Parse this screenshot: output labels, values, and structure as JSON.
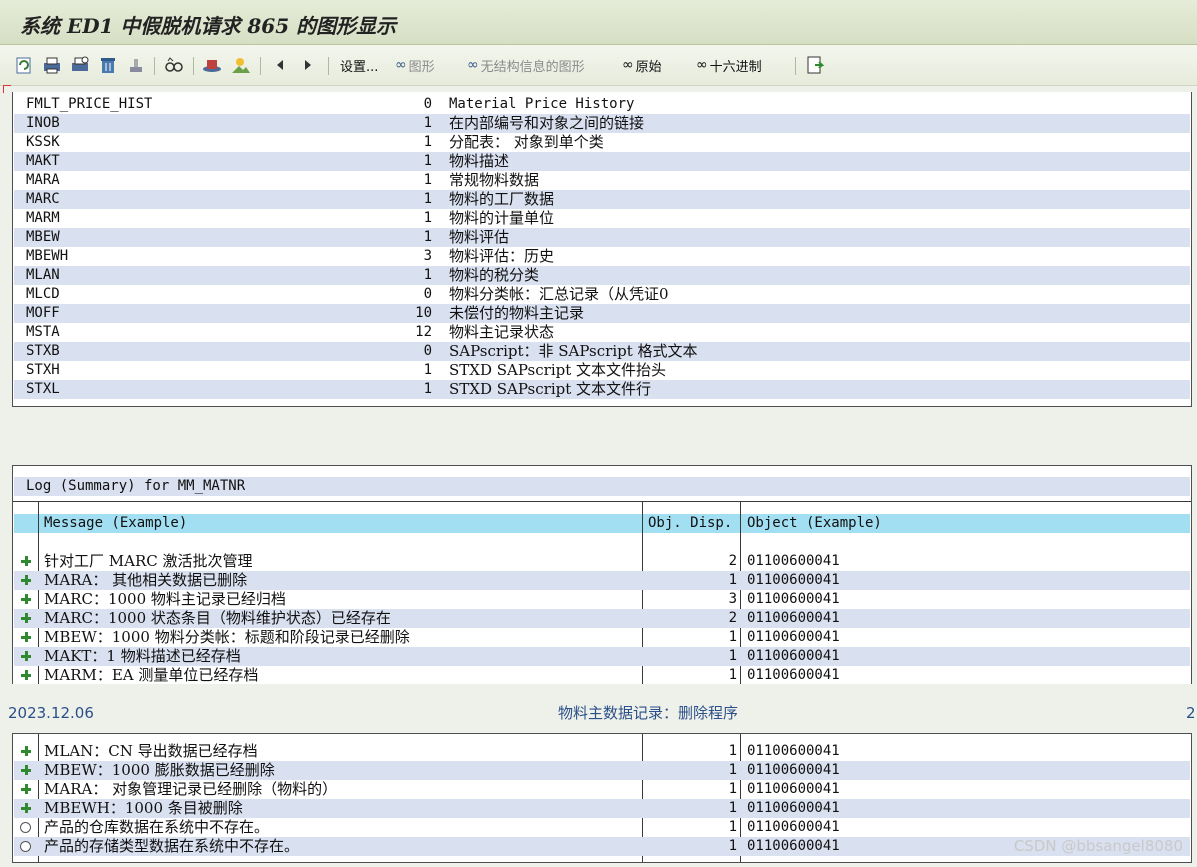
{
  "window": {
    "title": "系统 ED1 中假脱机请求 865 的图形显示"
  },
  "toolbar": {
    "settings_label": "设置...",
    "graphic_label": "图形",
    "unstructured_label": "无结构信息的图形",
    "raw_label": "原始",
    "hex_label": "十六进制"
  },
  "tables": [
    {
      "name": "FMLT_PRICE_HIST",
      "count": "0",
      "desc": "Material Price History"
    },
    {
      "name": "INOB",
      "count": "1",
      "desc": "在内部编号和对象之间的链接"
    },
    {
      "name": "KSSK",
      "count": "1",
      "desc": "分配表： 对象到单个类"
    },
    {
      "name": "MAKT",
      "count": "1",
      "desc": "物料描述"
    },
    {
      "name": "MARA",
      "count": "1",
      "desc": "常规物料数据"
    },
    {
      "name": "MARC",
      "count": "1",
      "desc": "物料的工厂数据"
    },
    {
      "name": "MARM",
      "count": "1",
      "desc": "物料的计量单位"
    },
    {
      "name": "MBEW",
      "count": "1",
      "desc": "物料评估"
    },
    {
      "name": "MBEWH",
      "count": "3",
      "desc": "物料评估：历史"
    },
    {
      "name": "MLAN",
      "count": "1",
      "desc": "物料的税分类"
    },
    {
      "name": "MLCD",
      "count": "0",
      "desc": "物料分类帐：汇总记录（从凭证0"
    },
    {
      "name": "MOFF",
      "count": "10",
      "desc": "未偿付的物料主记录"
    },
    {
      "name": "MSTA",
      "count": "12",
      "desc": "物料主记录状态"
    },
    {
      "name": "STXB",
      "count": "0",
      "desc": "SAPscript：非 SAPscript 格式文本"
    },
    {
      "name": "STXH",
      "count": "1",
      "desc": "STXD SAPscript 文本文件抬头"
    },
    {
      "name": "STXL",
      "count": "1",
      "desc": "STXD SAPscript 文本文件行"
    }
  ],
  "log": {
    "title": "Log (Summary) for MM_MATNR",
    "col_message": "Message (Example)",
    "col_objdisp": "Obj. Disp.",
    "col_object": "Object (Example)",
    "rows_page1": [
      {
        "msg": "针对工厂 MARC 激活批次管理",
        "count": "2",
        "obj": "01100600041",
        "icon": "plus"
      },
      {
        "msg": "MARA： 其他相关数据已删除",
        "count": "1",
        "obj": "01100600041",
        "icon": "plus"
      },
      {
        "msg": "MARC：1000 物料主记录已经归档",
        "count": "3",
        "obj": "01100600041",
        "icon": "plus"
      },
      {
        "msg": "MARC：1000 状态条目（物料维护状态）已经存在",
        "count": "2",
        "obj": "01100600041",
        "icon": "plus"
      },
      {
        "msg": "MBEW：1000 物料分类帐：标题和阶段记录已经删除",
        "count": "1",
        "obj": "01100600041",
        "icon": "plus"
      },
      {
        "msg": "MAKT：1 物料描述已经存档",
        "count": "1",
        "obj": "01100600041",
        "icon": "plus"
      },
      {
        "msg": "MARM：EA 测量单位已经存档",
        "count": "1",
        "obj": "01100600041",
        "icon": "plus"
      }
    ],
    "rows_page2": [
      {
        "msg": "MLAN：CN 导出数据已经存档",
        "count": "1",
        "obj": "01100600041",
        "icon": "plus"
      },
      {
        "msg": "MBEW：1000  膨胀数据已经删除",
        "count": "1",
        "obj": "01100600041",
        "icon": "plus"
      },
      {
        "msg": "MARA： 对象管理记录已经删除（物料的）",
        "count": "1",
        "obj": "01100600041",
        "icon": "plus"
      },
      {
        "msg": "MBEWH：1000 条目被删除",
        "count": "1",
        "obj": "01100600041",
        "icon": "plus"
      },
      {
        "msg": "产品的仓库数据在系统中不存在。",
        "count": "1",
        "obj": "01100600041",
        "icon": "circle"
      },
      {
        "msg": "产品的存储类型数据在系统中不存在。",
        "count": "1",
        "obj": "01100600041",
        "icon": "circle"
      }
    ]
  },
  "footer": {
    "date": "2023.12.06",
    "title": "物料主数据记录：删除程序",
    "page": "2"
  },
  "watermark": "CSDN @bbsangel8080"
}
